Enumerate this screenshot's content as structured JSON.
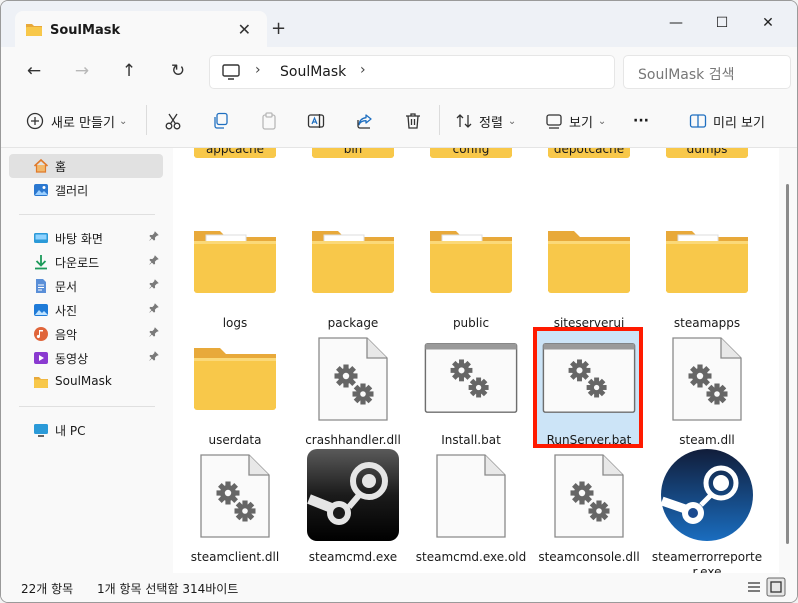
{
  "window": {
    "tab_title": "SoulMask",
    "tab_close": "✕",
    "tab_add": "+",
    "minimize": "—",
    "maximize": "☐",
    "close": "✕"
  },
  "nav": {
    "back": "←",
    "forward": "→",
    "up": "↑",
    "refresh": "↻",
    "chevron": "›",
    "address_segment": "SoulMask",
    "search_placeholder": "SoulMask 검색"
  },
  "toolbar": {
    "new_label": "새로 만들기",
    "sort_label": "정렬",
    "view_label": "보기",
    "more_label": "···",
    "preview_label": "미리 보기",
    "caret": "⌄"
  },
  "sidebar": {
    "items": [
      {
        "label": "홈",
        "icon": "home-icon",
        "selected": true
      },
      {
        "label": "갤러리",
        "icon": "gallery-icon"
      },
      {
        "label": "바탕 화면",
        "icon": "desktop-icon",
        "pinned": true
      },
      {
        "label": "다운로드",
        "icon": "download-icon",
        "pinned": true
      },
      {
        "label": "문서",
        "icon": "documents-icon",
        "pinned": true
      },
      {
        "label": "사진",
        "icon": "pictures-icon",
        "pinned": true
      },
      {
        "label": "음악",
        "icon": "music-icon",
        "pinned": true
      },
      {
        "label": "동영상",
        "icon": "videos-icon",
        "pinned": true
      },
      {
        "label": "SoulMask",
        "icon": "folder-icon"
      },
      {
        "label": "내 PC",
        "icon": "pc-icon"
      }
    ],
    "pin_glyph": "📌"
  },
  "files": [
    {
      "name": "appcache",
      "type": "folder"
    },
    {
      "name": "bin",
      "type": "folder"
    },
    {
      "name": "config",
      "type": "folder"
    },
    {
      "name": "depotcache",
      "type": "folder"
    },
    {
      "name": "dumps",
      "type": "folder"
    },
    {
      "name": "logs",
      "type": "folder"
    },
    {
      "name": "package",
      "type": "folder"
    },
    {
      "name": "public",
      "type": "folder"
    },
    {
      "name": "siteserverui",
      "type": "folder"
    },
    {
      "name": "steamapps",
      "type": "folder"
    },
    {
      "name": "userdata",
      "type": "folder"
    },
    {
      "name": "crashhandler.dll",
      "type": "dll"
    },
    {
      "name": "Install.bat",
      "type": "bat"
    },
    {
      "name": "RunServer.bat",
      "type": "bat",
      "selected": true
    },
    {
      "name": "steam.dll",
      "type": "dll"
    },
    {
      "name": "steamclient.dll",
      "type": "dll"
    },
    {
      "name": "steamcmd.exe",
      "type": "steamcmd"
    },
    {
      "name": "steamcmd.exe.old",
      "type": "blank"
    },
    {
      "name": "steamconsole.dll",
      "type": "dll"
    },
    {
      "name": "steamerrorreporter.exe",
      "type": "steamexe"
    }
  ],
  "status": {
    "count": "22개 항목",
    "selection": "1개 항목 선택함 314바이트"
  },
  "colors": {
    "accent": "#0067c0",
    "selection_fill": "#cce4f7",
    "highlight_border": "#ff1a00",
    "folder": "#f8c84a"
  }
}
